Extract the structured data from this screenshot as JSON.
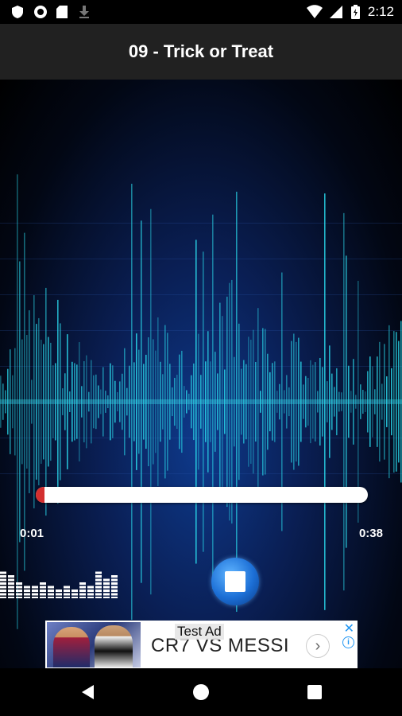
{
  "status_bar": {
    "time": "2:12",
    "left_icons": [
      "shield-icon",
      "circle-icon",
      "sd-card-icon",
      "download-icon"
    ],
    "right_icons": [
      "wifi-icon",
      "signal-icon",
      "battery-icon"
    ]
  },
  "player": {
    "title": "09 - Trick or Treat",
    "current_time": "0:01",
    "total_time": "0:38",
    "progress": 0.026,
    "control": "stop-icon"
  },
  "ad": {
    "label": "Test Ad",
    "headline": "CR7 VS MESSI",
    "go_symbol": "›",
    "close_symbol": "✕",
    "info_symbol": "i"
  },
  "colors": {
    "title_bar": "#212121",
    "waveform": "#29d3e6",
    "progress_fill": "#d32f2f",
    "ad_accent": "#2196f3"
  }
}
